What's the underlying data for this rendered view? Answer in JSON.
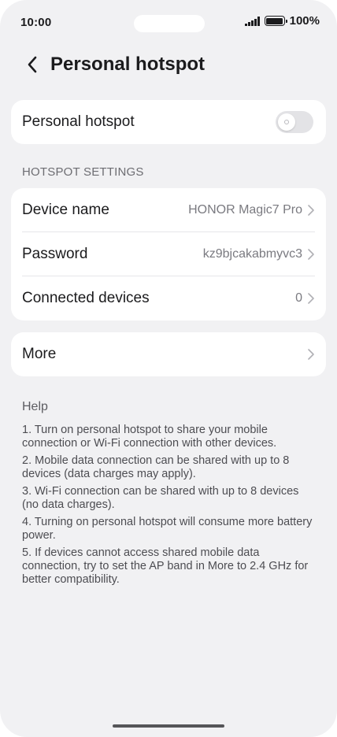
{
  "status_bar": {
    "time": "10:00",
    "battery": "100%"
  },
  "header": {
    "title": "Personal hotspot"
  },
  "hotspot_toggle": {
    "label": "Personal hotspot",
    "enabled": false
  },
  "settings_section": {
    "title": "HOTSPOT SETTINGS",
    "items": [
      {
        "label": "Device name",
        "value": "HONOR Magic7 Pro"
      },
      {
        "label": "Password",
        "value": "kz9bjcakabmyvc3"
      },
      {
        "label": "Connected devices",
        "value": "0"
      }
    ]
  },
  "more": {
    "label": "More"
  },
  "help": {
    "title": "Help",
    "items": [
      "1. Turn on personal hotspot to share your mobile connection or Wi-Fi connection with other devices.",
      "2. Mobile data connection can be shared with up to 8 devices (data charges may apply).",
      "3. Wi-Fi connection can be shared with up to 8 devices (no data charges).",
      "4. Turning on personal hotspot will consume more battery power.",
      "5. If devices cannot access shared mobile data connection, try to set the AP band in More to 2.4 GHz for better compatibility."
    ]
  },
  "icons": {
    "back": "chevron-left-icon",
    "chevron": "chevron-right-icon",
    "signal": "signal-icon",
    "battery": "battery-icon"
  },
  "colors": {
    "background": "#f1f1f3",
    "card": "#ffffff",
    "text_primary": "#1b1b1d",
    "text_secondary": "#7a7a80",
    "toggle_off": "#e3e3e6"
  }
}
